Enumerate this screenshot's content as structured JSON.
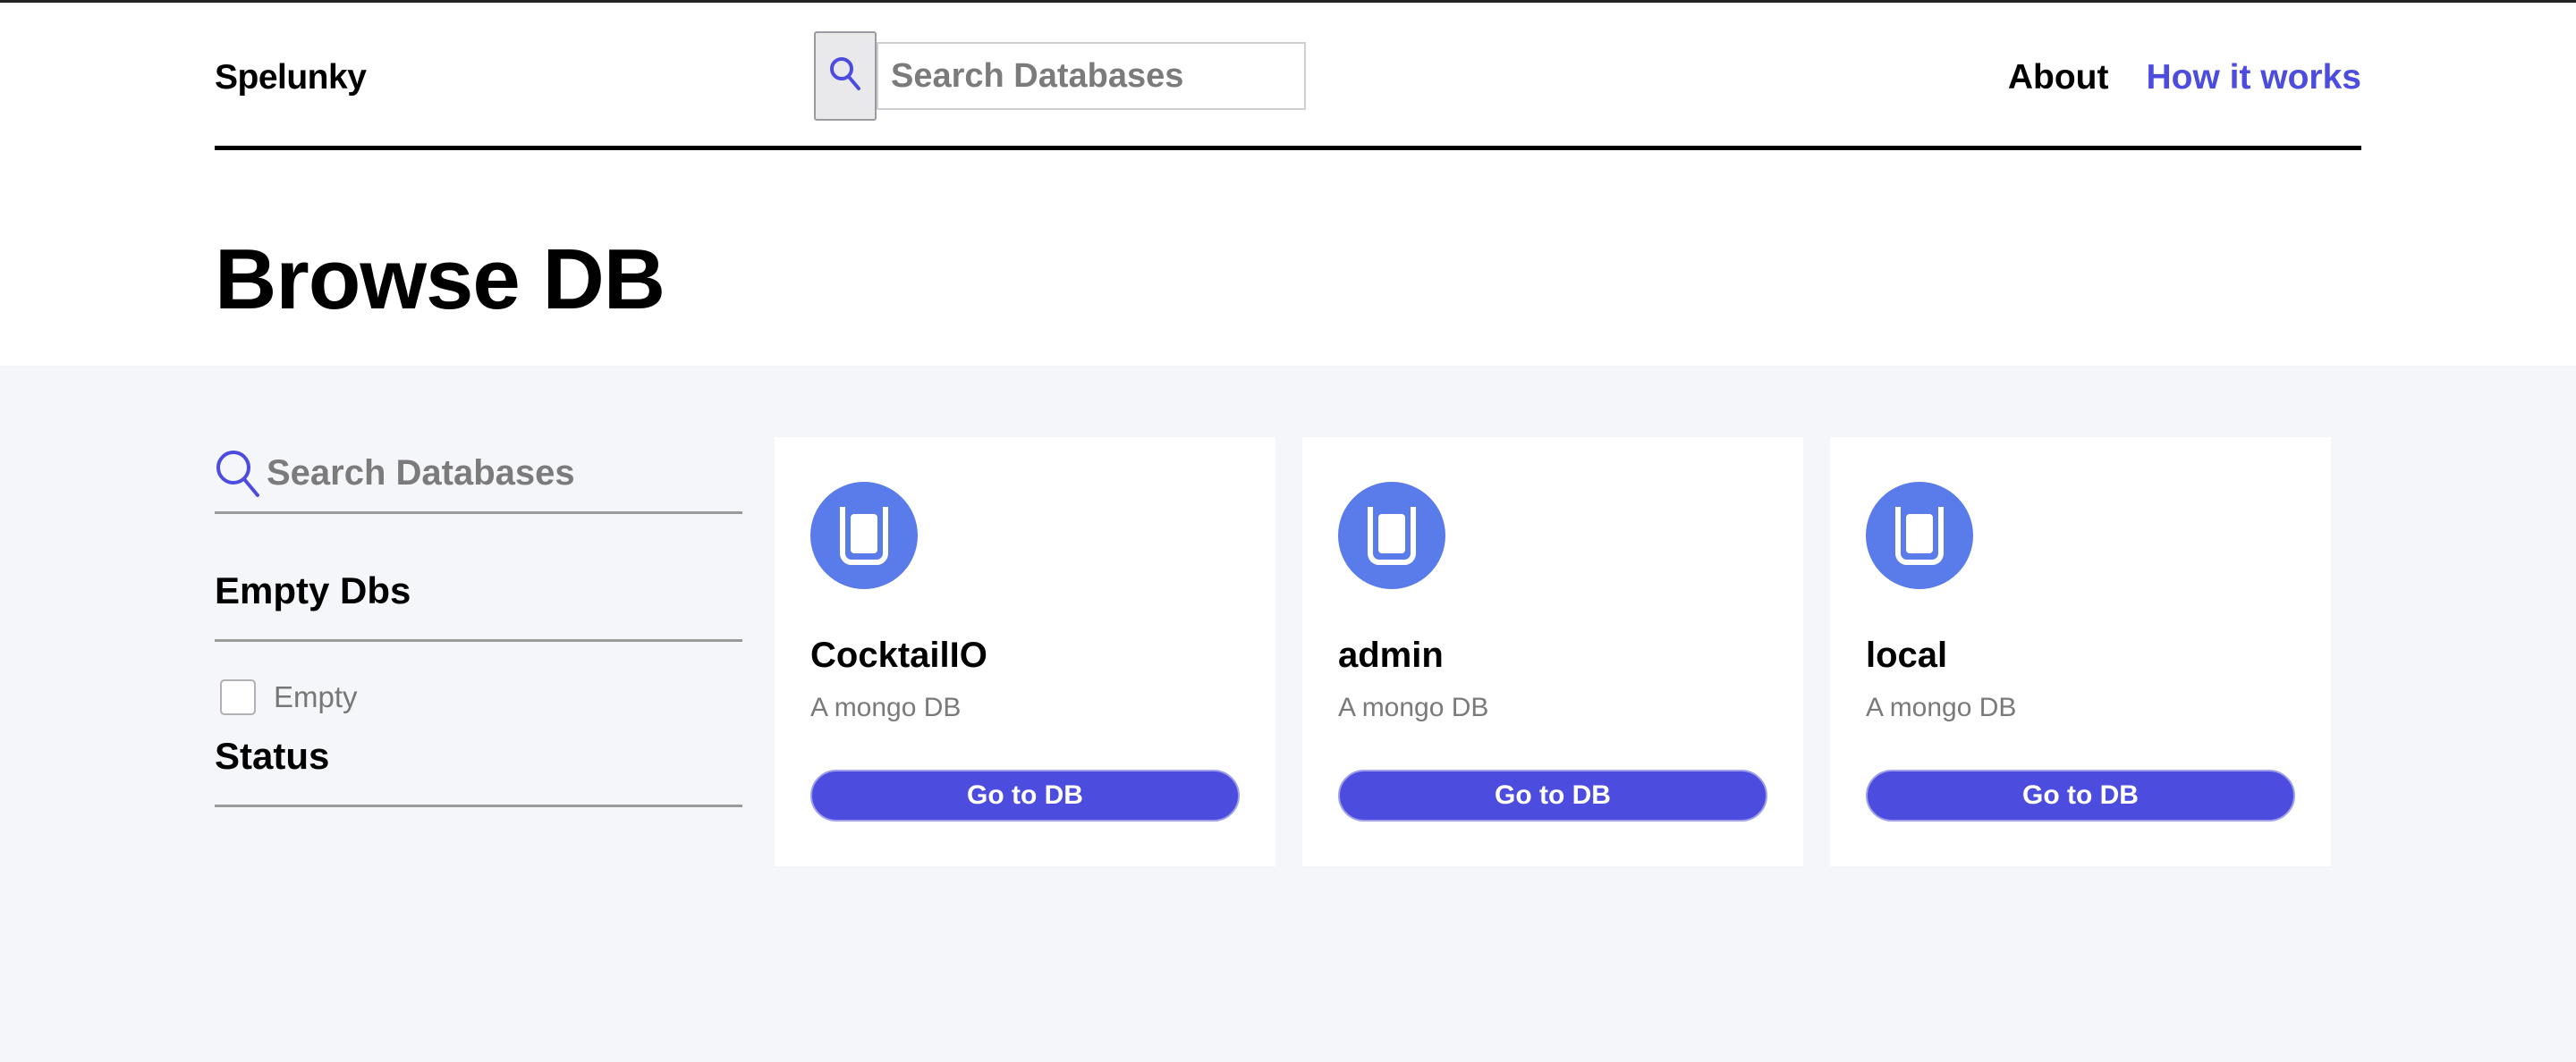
{
  "header": {
    "brand": "Spelunky",
    "search": {
      "placeholder": "Search Databases"
    },
    "nav": [
      {
        "label": "About"
      },
      {
        "label": "How it works"
      }
    ],
    "accent_color": "#4c4cde"
  },
  "page": {
    "title": "Browse DB"
  },
  "sidebar": {
    "search": {
      "placeholder": "Search Databases"
    },
    "filters": [
      {
        "title": "Empty Dbs",
        "options": [
          {
            "label": "Empty",
            "checked": false
          }
        ]
      },
      {
        "title": "Status",
        "options": []
      }
    ]
  },
  "cards": [
    {
      "name": "CocktailIO",
      "description": "A mongo DB",
      "button": "Go to DB",
      "icon": "database-icon"
    },
    {
      "name": "admin",
      "description": "A mongo DB",
      "button": "Go to DB",
      "icon": "database-icon"
    },
    {
      "name": "local",
      "description": "A mongo DB",
      "button": "Go to DB",
      "icon": "database-icon"
    }
  ]
}
